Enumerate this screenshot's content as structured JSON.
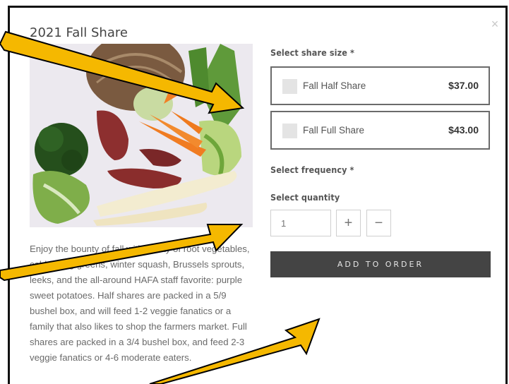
{
  "modal": {
    "title": "2021 Fall Share",
    "close_glyph": "×",
    "description": "Enjoy the bounty of fall with plenty of root vegetables, cold-loving greens, winter squash, Brussels sprouts, leeks, and the all-around HAFA staff favorite: purple sweet potatoes. Half shares are packed in a 5/9 bushel box, and will feed 1-2 veggie fanatics or a family that also likes to shop the farmers market. Full shares are packed in a 3/4 bushel box, and feed 2-3 veggie fanatics or 4-6 moderate eaters."
  },
  "share_size": {
    "label": "Select share size *",
    "options": [
      {
        "name": "Fall Half Share",
        "price": "$37.00"
      },
      {
        "name": "Fall Full Share",
        "price": "$43.00"
      }
    ]
  },
  "frequency": {
    "label": "Select frequency *"
  },
  "quantity": {
    "label": "Select quantity",
    "value": "1",
    "plus": "+",
    "minus": "−"
  },
  "add_button": {
    "label": "ADD TO ORDER"
  },
  "colors": {
    "arrow_fill": "#f5b800",
    "arrow_stroke": "#000000",
    "button_bg": "#444444"
  },
  "icons": [
    "close-icon",
    "plus-icon",
    "minus-icon",
    "checkbox-icon",
    "annotation-arrow"
  ]
}
